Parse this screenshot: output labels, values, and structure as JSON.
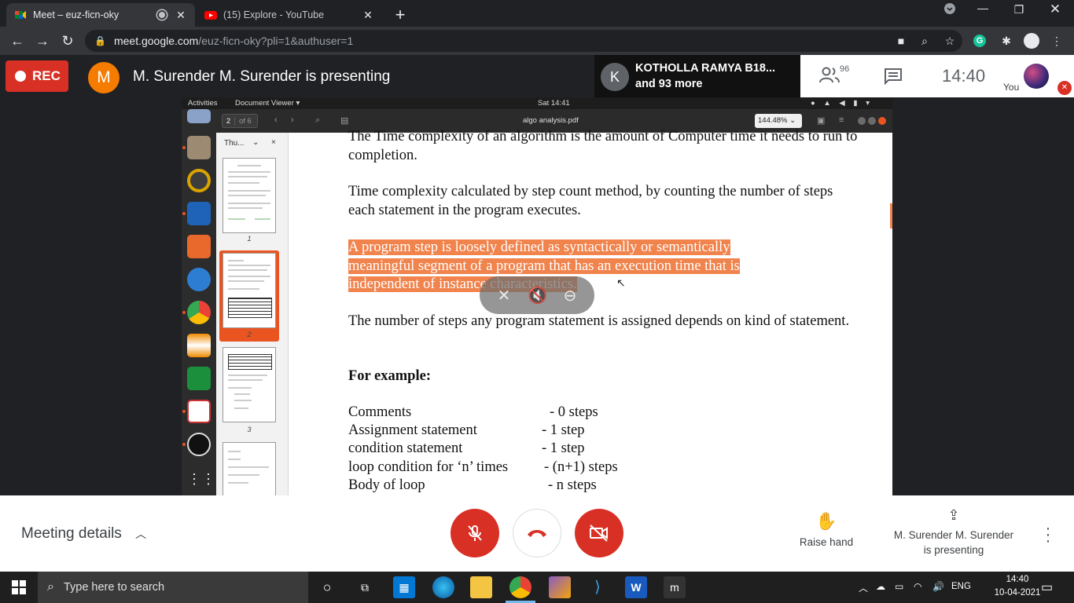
{
  "browser": {
    "tabs": [
      {
        "title": "Meet – euz-ficn-oky",
        "active": true
      },
      {
        "title": "(15) Explore - YouTube",
        "active": false
      }
    ],
    "url_host": "meet.google.com",
    "url_path": "/euz-ficn-oky?pli=1&authuser=1",
    "profile_initial": "G"
  },
  "meet": {
    "rec_label": "REC",
    "presenter_initial": "M",
    "presenting_title": "M. Surender M. Surender is presenting",
    "participant_initial": "K",
    "participant_name": "KOTHOLLA RAMYA B18...",
    "participant_more": "and 93 more",
    "people_count": "96",
    "time": "14:40",
    "self_label": "You",
    "meeting_details": "Meeting details",
    "raise_hand": "Raise hand",
    "presenting_line1": "M. Surender M. Surender",
    "presenting_line2": "is presenting",
    "colors": {
      "rec": "#d93025",
      "presenter_avatar": "#f57c00",
      "highlight": "#f1834c"
    }
  },
  "ubuntu": {
    "activities": "Activities",
    "app_menu": "Document Viewer ▾",
    "clock": "Sat 14:41",
    "page_current": "2",
    "page_of": "of 6",
    "doc_title": "algo analysis.pdf",
    "zoom": "144.48% ⌄",
    "sidebar_mode": "Thu...",
    "thumb_numbers": [
      "1",
      "2",
      "3"
    ]
  },
  "document": {
    "p1": "The Time complexity of an algorithm is the amount of Computer time it needs to run to completion.",
    "p2": "Time complexity calculated by step count method, by counting the number of steps each statement in the program executes.",
    "p3": "A program step is loosely defined as syntactically or semantically meaningful segment of a program that has an execution time that is independent of instance characteristics.",
    "p4": "The number of steps any program statement is assigned depends on kind of statement.",
    "example_heading": "For example:",
    "rows": [
      {
        "label": "Comments",
        "value": "- 0 steps"
      },
      {
        "label": "Assignment statement",
        "value": "- 1 step"
      },
      {
        "label": "condition statement",
        "value": "- 1 step"
      },
      {
        "label": "loop condition for ‘n’ times",
        "value": "- (n+1) steps"
      },
      {
        "label": "Body of loop",
        "value": "- n steps"
      }
    ]
  },
  "taskbar": {
    "search_placeholder": "Type here to search",
    "language": "ENG",
    "time": "14:40",
    "date": "10-04-2021"
  }
}
